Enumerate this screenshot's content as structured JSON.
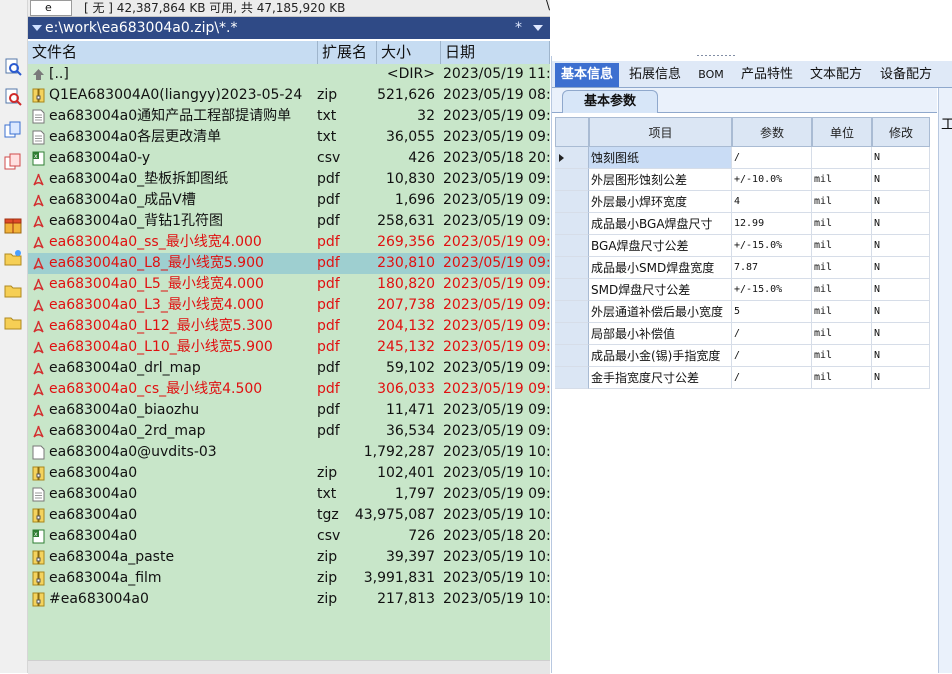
{
  "drive_bar": {
    "drive": "e",
    "free_text": "[ 无 ]  42,387,864 KB 可用,  共 47,185,920 KB",
    "right_mark": "\\"
  },
  "path_bar": {
    "path": "e:\\work\\ea683004a0.zip\\*.*",
    "filter": "*"
  },
  "columns": {
    "name": "文件名",
    "ext": "扩展名",
    "size": "大小",
    "date": "日期"
  },
  "files": [
    {
      "name": "[..]",
      "ext": "",
      "size": "<DIR>",
      "date": "2023/05/19 11:0",
      "icon": "updir",
      "red": false,
      "selected": false
    },
    {
      "name": "Q1EA683004A0(liangyy)2023-05-24",
      "ext": "zip",
      "size": "521,626",
      "date": "2023/05/19 08:5",
      "icon": "zip",
      "red": false,
      "selected": false
    },
    {
      "name": "ea683004a0通知产品工程部提请购单",
      "ext": "txt",
      "size": "32",
      "date": "2023/05/19 09:5",
      "icon": "txt",
      "red": false,
      "selected": false
    },
    {
      "name": "ea683004a0各层更改清单",
      "ext": "txt",
      "size": "36,055",
      "date": "2023/05/19 09:2",
      "icon": "txt",
      "red": false,
      "selected": false
    },
    {
      "name": "ea683004a0-y",
      "ext": "csv",
      "size": "426",
      "date": "2023/05/18 20:1",
      "icon": "csv",
      "red": false,
      "selected": false
    },
    {
      "name": "ea683004a0_垫板拆卸图纸",
      "ext": "pdf",
      "size": "10,830",
      "date": "2023/05/19 09:2",
      "icon": "pdf",
      "red": false,
      "selected": false
    },
    {
      "name": "ea683004a0_成品V槽",
      "ext": "pdf",
      "size": "1,696",
      "date": "2023/05/19 09:2",
      "icon": "pdf",
      "red": false,
      "selected": false
    },
    {
      "name": "ea683004a0_背钻1孔符图",
      "ext": "pdf",
      "size": "258,631",
      "date": "2023/05/19 09:2",
      "icon": "pdf",
      "red": false,
      "selected": false
    },
    {
      "name": "ea683004a0_ss_最小线宽4.000",
      "ext": "pdf",
      "size": "269,356",
      "date": "2023/05/19 09:2",
      "icon": "pdf",
      "red": true,
      "selected": false
    },
    {
      "name": "ea683004a0_L8_最小线宽5.900",
      "ext": "pdf",
      "size": "230,810",
      "date": "2023/05/19 09:2",
      "icon": "pdf",
      "red": true,
      "selected": true
    },
    {
      "name": "ea683004a0_L5_最小线宽4.000",
      "ext": "pdf",
      "size": "180,820",
      "date": "2023/05/19 09:2",
      "icon": "pdf",
      "red": true,
      "selected": false
    },
    {
      "name": "ea683004a0_L3_最小线宽4.000",
      "ext": "pdf",
      "size": "207,738",
      "date": "2023/05/19 09:2",
      "icon": "pdf",
      "red": true,
      "selected": false
    },
    {
      "name": "ea683004a0_L12_最小线宽5.300",
      "ext": "pdf",
      "size": "204,132",
      "date": "2023/05/19 09:2",
      "icon": "pdf",
      "red": true,
      "selected": false
    },
    {
      "name": "ea683004a0_L10_最小线宽5.900",
      "ext": "pdf",
      "size": "245,132",
      "date": "2023/05/19 09:2",
      "icon": "pdf",
      "red": true,
      "selected": false
    },
    {
      "name": "ea683004a0_drl_map",
      "ext": "pdf",
      "size": "59,102",
      "date": "2023/05/19 09:2",
      "icon": "pdf",
      "red": false,
      "selected": false
    },
    {
      "name": "ea683004a0_cs_最小线宽4.500",
      "ext": "pdf",
      "size": "306,033",
      "date": "2023/05/19 09:2",
      "icon": "pdf",
      "red": true,
      "selected": false
    },
    {
      "name": "ea683004a0_biaozhu",
      "ext": "pdf",
      "size": "11,471",
      "date": "2023/05/19 09:2",
      "icon": "pdf",
      "red": false,
      "selected": false
    },
    {
      "name": "ea683004a0_2rd_map",
      "ext": "pdf",
      "size": "36,534",
      "date": "2023/05/19 09:2",
      "icon": "pdf",
      "red": false,
      "selected": false
    },
    {
      "name": "ea683004a0@uvdits-03",
      "ext": "",
      "size": "1,792,287",
      "date": "2023/05/19 10:0",
      "icon": "file",
      "red": false,
      "selected": false
    },
    {
      "name": "ea683004a0",
      "ext": "zip",
      "size": "102,401",
      "date": "2023/05/19 10:1",
      "icon": "zip",
      "red": false,
      "selected": false
    },
    {
      "name": "ea683004a0",
      "ext": "txt",
      "size": "1,797",
      "date": "2023/05/19 09:2",
      "icon": "txt",
      "red": false,
      "selected": false
    },
    {
      "name": "ea683004a0",
      "ext": "tgz",
      "size": "43,975,087",
      "date": "2023/05/19 10:0",
      "icon": "zip",
      "red": false,
      "selected": false
    },
    {
      "name": "ea683004a0",
      "ext": "csv",
      "size": "726",
      "date": "2023/05/18 20:1",
      "icon": "csv",
      "red": false,
      "selected": false
    },
    {
      "name": "ea683004a_paste",
      "ext": "zip",
      "size": "39,397",
      "date": "2023/05/19 10:0",
      "icon": "zip",
      "red": false,
      "selected": false
    },
    {
      "name": "ea683004a_film",
      "ext": "zip",
      "size": "3,991,831",
      "date": "2023/05/19 10:0",
      "icon": "zip",
      "red": false,
      "selected": false
    },
    {
      "name": "#ea683004a0",
      "ext": "zip",
      "size": "217,813",
      "date": "2023/05/19 10:1",
      "icon": "zip",
      "red": false,
      "selected": false
    }
  ],
  "right_app": {
    "tabs": [
      "基本信息",
      "拓展信息",
      "BOM",
      "产品特性",
      "文本配方",
      "设备配方"
    ],
    "active_tab": 0,
    "subtab": "基本参数",
    "side_char": "工",
    "grid": {
      "headers": [
        "项目",
        "参数",
        "单位",
        "修改"
      ],
      "rows": [
        {
          "item": "蚀刻图纸",
          "param": "/",
          "unit": "",
          "mod": "N",
          "current": true
        },
        {
          "item": "外层图形蚀刻公差",
          "param": "+/-10.0%",
          "unit": "mil",
          "mod": "N",
          "current": false
        },
        {
          "item": "外层最小焊环宽度",
          "param": "4",
          "unit": "mil",
          "mod": "N",
          "current": false
        },
        {
          "item": "成品最小BGA焊盘尺寸",
          "param": "12.99",
          "unit": "mil",
          "mod": "N",
          "current": false
        },
        {
          "item": "BGA焊盘尺寸公差",
          "param": "+/-15.0%",
          "unit": "mil",
          "mod": "N",
          "current": false
        },
        {
          "item": "成品最小SMD焊盘宽度",
          "param": "7.87",
          "unit": "mil",
          "mod": "N",
          "current": false
        },
        {
          "item": "SMD焊盘尺寸公差",
          "param": "+/-15.0%",
          "unit": "mil",
          "mod": "N",
          "current": false
        },
        {
          "item": "外层通道补偿后最小宽度",
          "param": "5",
          "unit": "mil",
          "mod": "N",
          "current": false
        },
        {
          "item": "局部最小补偿值",
          "param": "/",
          "unit": "mil",
          "mod": "N",
          "current": false
        },
        {
          "item": "成品最小金(锡)手指宽度",
          "param": "/",
          "unit": "mil",
          "mod": "N",
          "current": false
        },
        {
          "item": "金手指宽度尺寸公差",
          "param": "/",
          "unit": "mil",
          "mod": "N",
          "current": false
        }
      ]
    }
  },
  "left_toolbar": [
    "find-icon",
    "find-red-icon",
    "copy-icon",
    "compare-icon",
    "package-icon",
    "new-folder-icon",
    "folder-icon",
    "folder-icon-2"
  ],
  "colors": {
    "panel_bg": "#c8e6c9",
    "path_bg": "#2f4a86",
    "header_bg": "#c6dcf2",
    "selected_row": "#9ecfd0",
    "red_text": "#e01010",
    "active_tab": "#3c6fd0"
  }
}
